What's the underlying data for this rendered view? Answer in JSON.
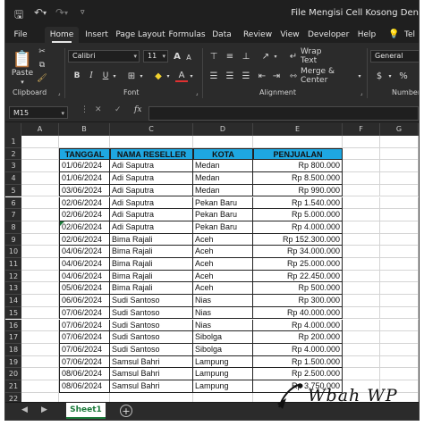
{
  "window": {
    "title": "File Mengisi Cell Kosong Den"
  },
  "menu": {
    "tabs": [
      "File",
      "Home",
      "Insert",
      "Page Layout",
      "Formulas",
      "Data",
      "Review",
      "View",
      "Developer",
      "Help",
      "Tel"
    ],
    "active": "Home"
  },
  "ribbon": {
    "clipboard": {
      "paste_label": "Paste",
      "group_label": "Clipboard"
    },
    "font": {
      "family": "Calibri",
      "size": "11",
      "group_label": "Font",
      "bold": "B",
      "italic": "I",
      "underline": "U",
      "grow": "A",
      "shrink": "A"
    },
    "alignment": {
      "wrap_text": "Wrap Text",
      "merge_center": "Merge & Center",
      "group_label": "Alignment"
    },
    "number": {
      "format": "General",
      "group_label": "Number"
    }
  },
  "formula_bar": {
    "name_box": "M15",
    "fx_label": "fx",
    "value": ""
  },
  "grid": {
    "columns": [
      "A",
      "B",
      "C",
      "D",
      "E",
      "F",
      "G"
    ],
    "row_numbers": [
      "1",
      "2",
      "3",
      "4",
      "5",
      "6",
      "7",
      "8",
      "9",
      "10",
      "11",
      "12",
      "13",
      "14",
      "15",
      "16",
      "17",
      "18",
      "19",
      "20",
      "21",
      "22"
    ],
    "table_headers": [
      "TANGGAL",
      "NAMA RESELLER",
      "KOTA",
      "PENJUALAN"
    ],
    "rows": [
      [
        "01/06/2024",
        "Adi Saputra",
        "Medan",
        "Rp 800.000"
      ],
      [
        "01/06/2024",
        "Adi Saputra",
        "Medan",
        "Rp 8.500.000"
      ],
      [
        "03/06/2024",
        "Adi Saputra",
        "Medan",
        "Rp 990.000"
      ],
      [
        "02/06/2024",
        "Adi Saputra",
        "Pekan Baru",
        "Rp 1.540.000"
      ],
      [
        "02/06/2024",
        "Adi Saputra",
        "Pekan Baru",
        "Rp 5.000.000"
      ],
      [
        "02/06/2024",
        "Adi Saputra",
        "Pekan Baru",
        "Rp 4.000.000"
      ],
      [
        "02/06/2024",
        "Bima Rajali",
        "Aceh",
        "Rp 152.300.000"
      ],
      [
        "04/06/2024",
        "Bima Rajali",
        "Aceh",
        "Rp 34.000.000"
      ],
      [
        "04/06/2024",
        "Bima Rajali",
        "Aceh",
        "Rp 25.000.000"
      ],
      [
        "04/06/2024",
        "Bima Rajali",
        "Aceh",
        "Rp 22.450.000"
      ],
      [
        "05/06/2024",
        "Bima Rajali",
        "Aceh",
        "Rp 500.000"
      ],
      [
        "06/06/2024",
        "Sudi Santoso",
        "Nias",
        "Rp 300.000"
      ],
      [
        "07/06/2024",
        "Sudi Santoso",
        "Nias",
        "Rp 40.000.000"
      ],
      [
        "07/06/2024",
        "Sudi Santoso",
        "Nias",
        "Rp 4.000.000"
      ],
      [
        "07/06/2024",
        "Sudi Santoso",
        "Sibolga",
        "Rp 200.000"
      ],
      [
        "07/06/2024",
        "Sudi Santoso",
        "Sibolga",
        "Rp 4.000.000"
      ],
      [
        "07/06/2024",
        "Samsul Bahri",
        "Lampung",
        "Rp 1.500.000"
      ],
      [
        "08/06/2024",
        "Samsul Bahri",
        "Lampung",
        "Rp 2.500.000"
      ],
      [
        "08/06/2024",
        "Samsul Bahri",
        "Lampung",
        "Rp 3.750.000"
      ]
    ]
  },
  "sheets": {
    "active": "Sheet1",
    "add": "+"
  },
  "watermark": {
    "text": "Wbah WP"
  },
  "colors": {
    "header_fill": "#1ea7e1",
    "sheet_tab_text": "#1b7a3a",
    "chrome": "#2b2b2b"
  }
}
